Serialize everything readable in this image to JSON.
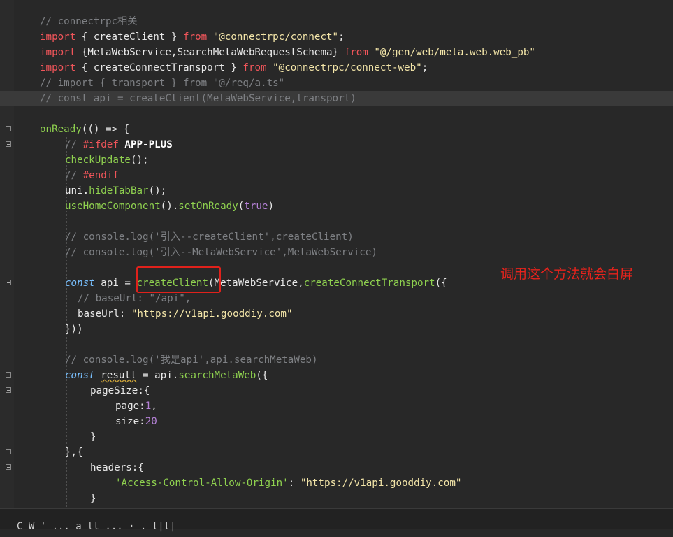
{
  "editor": {
    "lines": {
      "l0": "// connectrpc相关",
      "l1_kw": "import",
      "l1_mid": " { createClient } ",
      "l1_from": "from",
      "l1_str": "\"@connectrpc/connect\"",
      "l1_end": ";",
      "l2_kw": "import",
      "l2_mid": " {MetaWebService,SearchMetaWebRequestSchema} ",
      "l2_from": "from",
      "l2_str": "\"@/gen/web/meta.web.web_pb\"",
      "l3_kw": "import",
      "l3_mid": " { createConnectTransport } ",
      "l3_from": "from",
      "l3_str": "\"@connectrpc/connect-web\"",
      "l3_end": ";",
      "l4": "// import { transport } from \"@/req/a.ts\"",
      "l5": "// const api = createClient(MetaWebService,transport)",
      "l7_fn": "onReady",
      "l7_rest": "(() => {",
      "l8_cm": "// ",
      "l8_pp": "#ifdef",
      "l8_bold": " APP-PLUS",
      "l9_fn": "checkUpdate",
      "l9_rest": "();",
      "l10_cm": "// ",
      "l10_pp": "#endif",
      "l11_a": "uni.",
      "l11_fn": "hideTabBar",
      "l11_rest": "();",
      "l12_fn1": "useHomeComponent",
      "l12_mid": "().",
      "l12_fn2": "setOnReady",
      "l12_open": "(",
      "l12_bool": "true",
      "l12_close": ")",
      "l14": "// console.log('引入--createClient',createClient)",
      "l15": "// console.log('引入--MetaWebService',MetaWebService)",
      "l17_kw": "const",
      "l17_a": " api = ",
      "l17_fn": "createClient",
      "l17_b": "(MetaWebService,",
      "l17_fn2": "createConnectTransport",
      "l17_c": "({",
      "l18": "// baseUrl: \"/api\",",
      "l19_key": "baseUrl",
      "l19_colon": ": ",
      "l19_str": "\"https://v1api.gooddiy.com\"",
      "l20": "}))",
      "l22": "// console.log('我是api',api.searchMetaWeb)",
      "l23_kw": "const",
      "l23_sp": " ",
      "l23_var": "result",
      "l23_a": " = api.",
      "l23_fn": "searchMetaWeb",
      "l23_b": "({",
      "l24": "pageSize:{",
      "l25_key": "page:",
      "l25_num": "1",
      "l25_end": ",",
      "l26_key": "size:",
      "l26_num": "20",
      "l27": "}",
      "l28": "},{",
      "l29": "headers:{",
      "l30_key": "'Access-Control-Allow-Origin'",
      "l30_colon": ": ",
      "l30_str": "\"https://v1api.gooddiy.com\"",
      "l31": "}"
    },
    "annotation": "调用这个方法就会白屏",
    "annotation_color": "#e8231c"
  },
  "bottom_bar": {
    "text": "C  W  '  ...  a  ll  ...  ·  .  t|t|"
  }
}
